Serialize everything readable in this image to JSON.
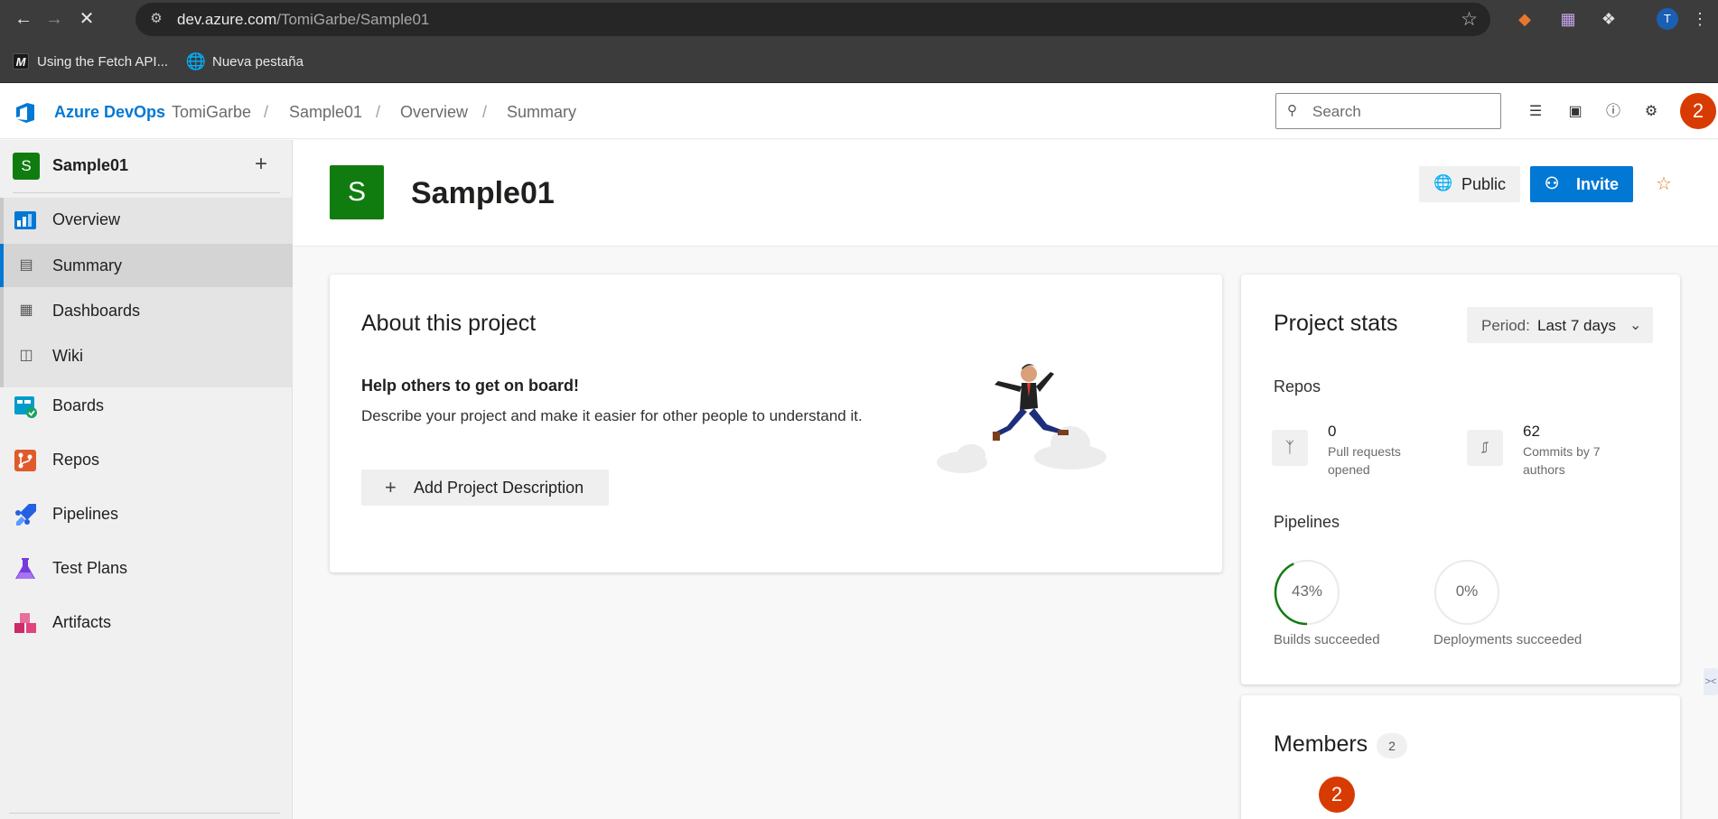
{
  "browser": {
    "url_host": "dev.azure.com",
    "url_path": "/TomiGarbe/Sample01",
    "bookmarks": [
      {
        "label": "Using the Fetch API..."
      },
      {
        "label": "Nueva pestaña"
      }
    ],
    "profile_initial": "T"
  },
  "header": {
    "brand": "Azure DevOps",
    "breadcrumbs": [
      "TomiGarbe",
      "Sample01",
      "Overview",
      "Summary"
    ],
    "search_placeholder": "Search",
    "notification_count": "2"
  },
  "sidebar": {
    "project_initial": "S",
    "project_name": "Sample01",
    "items": [
      {
        "label": "Overview"
      },
      {
        "label": "Summary"
      },
      {
        "label": "Dashboards"
      },
      {
        "label": "Wiki"
      },
      {
        "label": "Boards"
      },
      {
        "label": "Repos"
      },
      {
        "label": "Pipelines"
      },
      {
        "label": "Test Plans"
      },
      {
        "label": "Artifacts"
      }
    ]
  },
  "main": {
    "project_initial": "S",
    "title": "Sample01",
    "public_label": "Public",
    "invite_label": "Invite",
    "about": {
      "title": "About this project",
      "help_title": "Help others to get on board!",
      "help_desc": "Describe your project and make it easier for other people to understand it.",
      "add_button": "Add Project Description"
    },
    "stats": {
      "title": "Project stats",
      "period_prefix": "Period:",
      "period_value": "Last 7 days",
      "repos_label": "Repos",
      "pull_requests_value": "0",
      "pull_requests_desc": "Pull requests opened",
      "commits_value": "62",
      "commits_desc": "Commits by 7 authors",
      "pipelines_label": "Pipelines",
      "builds_percent": "43%",
      "builds_fraction": 0.43,
      "builds_caption": "Builds succeeded",
      "deployments_percent": "0%",
      "deployments_fraction": 0,
      "deployments_caption": "Deployments succeeded"
    },
    "members": {
      "title": "Members",
      "count": "2",
      "avatar_text": "2"
    }
  },
  "colors": {
    "accent": "#0078d4",
    "project_green": "#107c10",
    "user_orange": "#d83b01",
    "ring_green": "#107c10"
  }
}
